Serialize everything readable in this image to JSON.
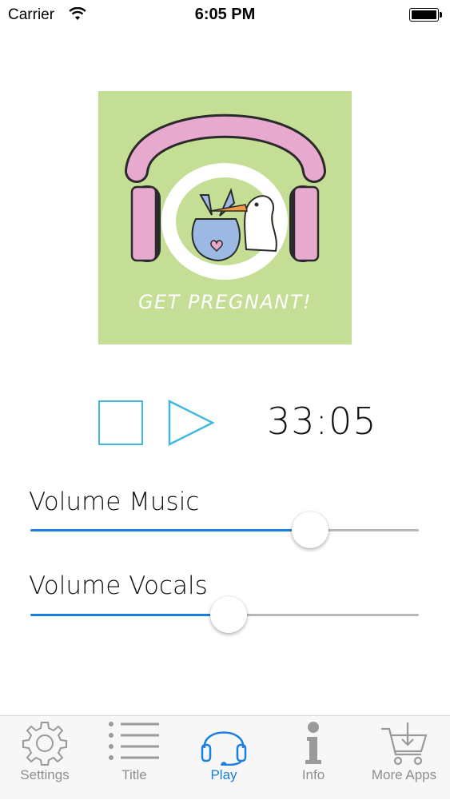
{
  "status_bar": {
    "carrier": "Carrier",
    "time": "6:05 PM"
  },
  "player": {
    "cover_caption": "GET PREGNANT!",
    "timer": "33:05",
    "volume_music": {
      "label": "Volume Music",
      "value": 0.72
    },
    "volume_vocals": {
      "label": "Volume Vocals",
      "value": 0.51
    }
  },
  "tab_bar": {
    "items": [
      {
        "label": "Settings",
        "icon": "gear-icon"
      },
      {
        "label": "Title",
        "icon": "list-icon"
      },
      {
        "label": "Play",
        "icon": "headphones-icon",
        "active": true
      },
      {
        "label": "Info",
        "icon": "info-icon"
      },
      {
        "label": "More Apps",
        "icon": "cart-icon"
      }
    ]
  },
  "colors": {
    "accent": "#1a7fe0",
    "stop_button": "#3fb8e0",
    "cover_bg": "#c4de95",
    "headphones": "#e8a9cf"
  }
}
